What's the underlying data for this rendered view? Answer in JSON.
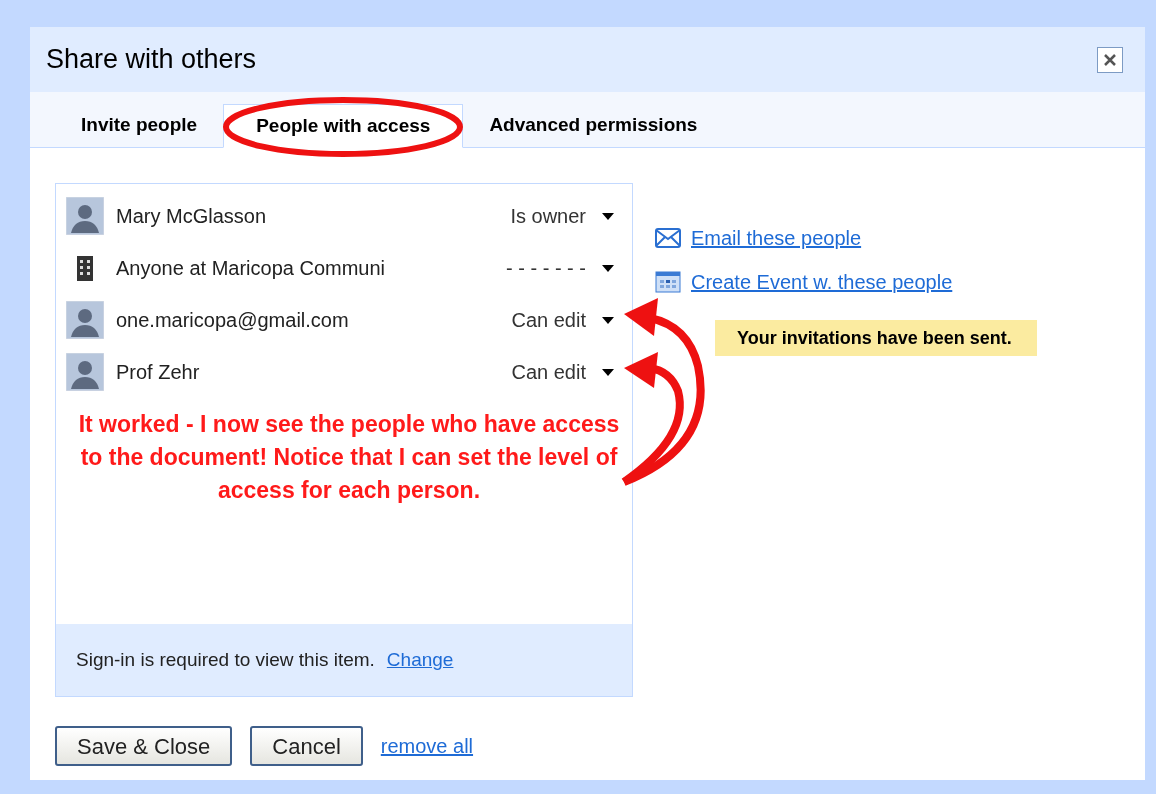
{
  "dialog": {
    "title": "Share with others"
  },
  "tabs": [
    {
      "label": "Invite people",
      "selected": false
    },
    {
      "label": "People with access",
      "selected": true
    },
    {
      "label": "Advanced permissions",
      "selected": false
    }
  ],
  "members": [
    {
      "kind": "person",
      "name": "Mary McGlasson",
      "access": "Is owner"
    },
    {
      "kind": "group",
      "name": "Anyone at Maricopa Communi",
      "access": "- - - - - - -"
    },
    {
      "kind": "person",
      "name": "one.maricopa@gmail.com",
      "access": "Can edit"
    },
    {
      "kind": "person",
      "name": "Prof Zehr",
      "access": "Can edit"
    }
  ],
  "sign_in": {
    "text": "Sign-in is required to view this item.",
    "link": "Change"
  },
  "actions": [
    {
      "kind": "email",
      "label": "Email these people"
    },
    {
      "kind": "event",
      "label": "Create Event w. these people"
    }
  ],
  "notice": "Your invitations have been sent.",
  "annotation": "It worked -  I now see the people who have access to the document! Notice that I can set the level of access for each person.",
  "buttons": [
    "Save & Close",
    "Cancel"
  ],
  "remove_link": "remove all"
}
